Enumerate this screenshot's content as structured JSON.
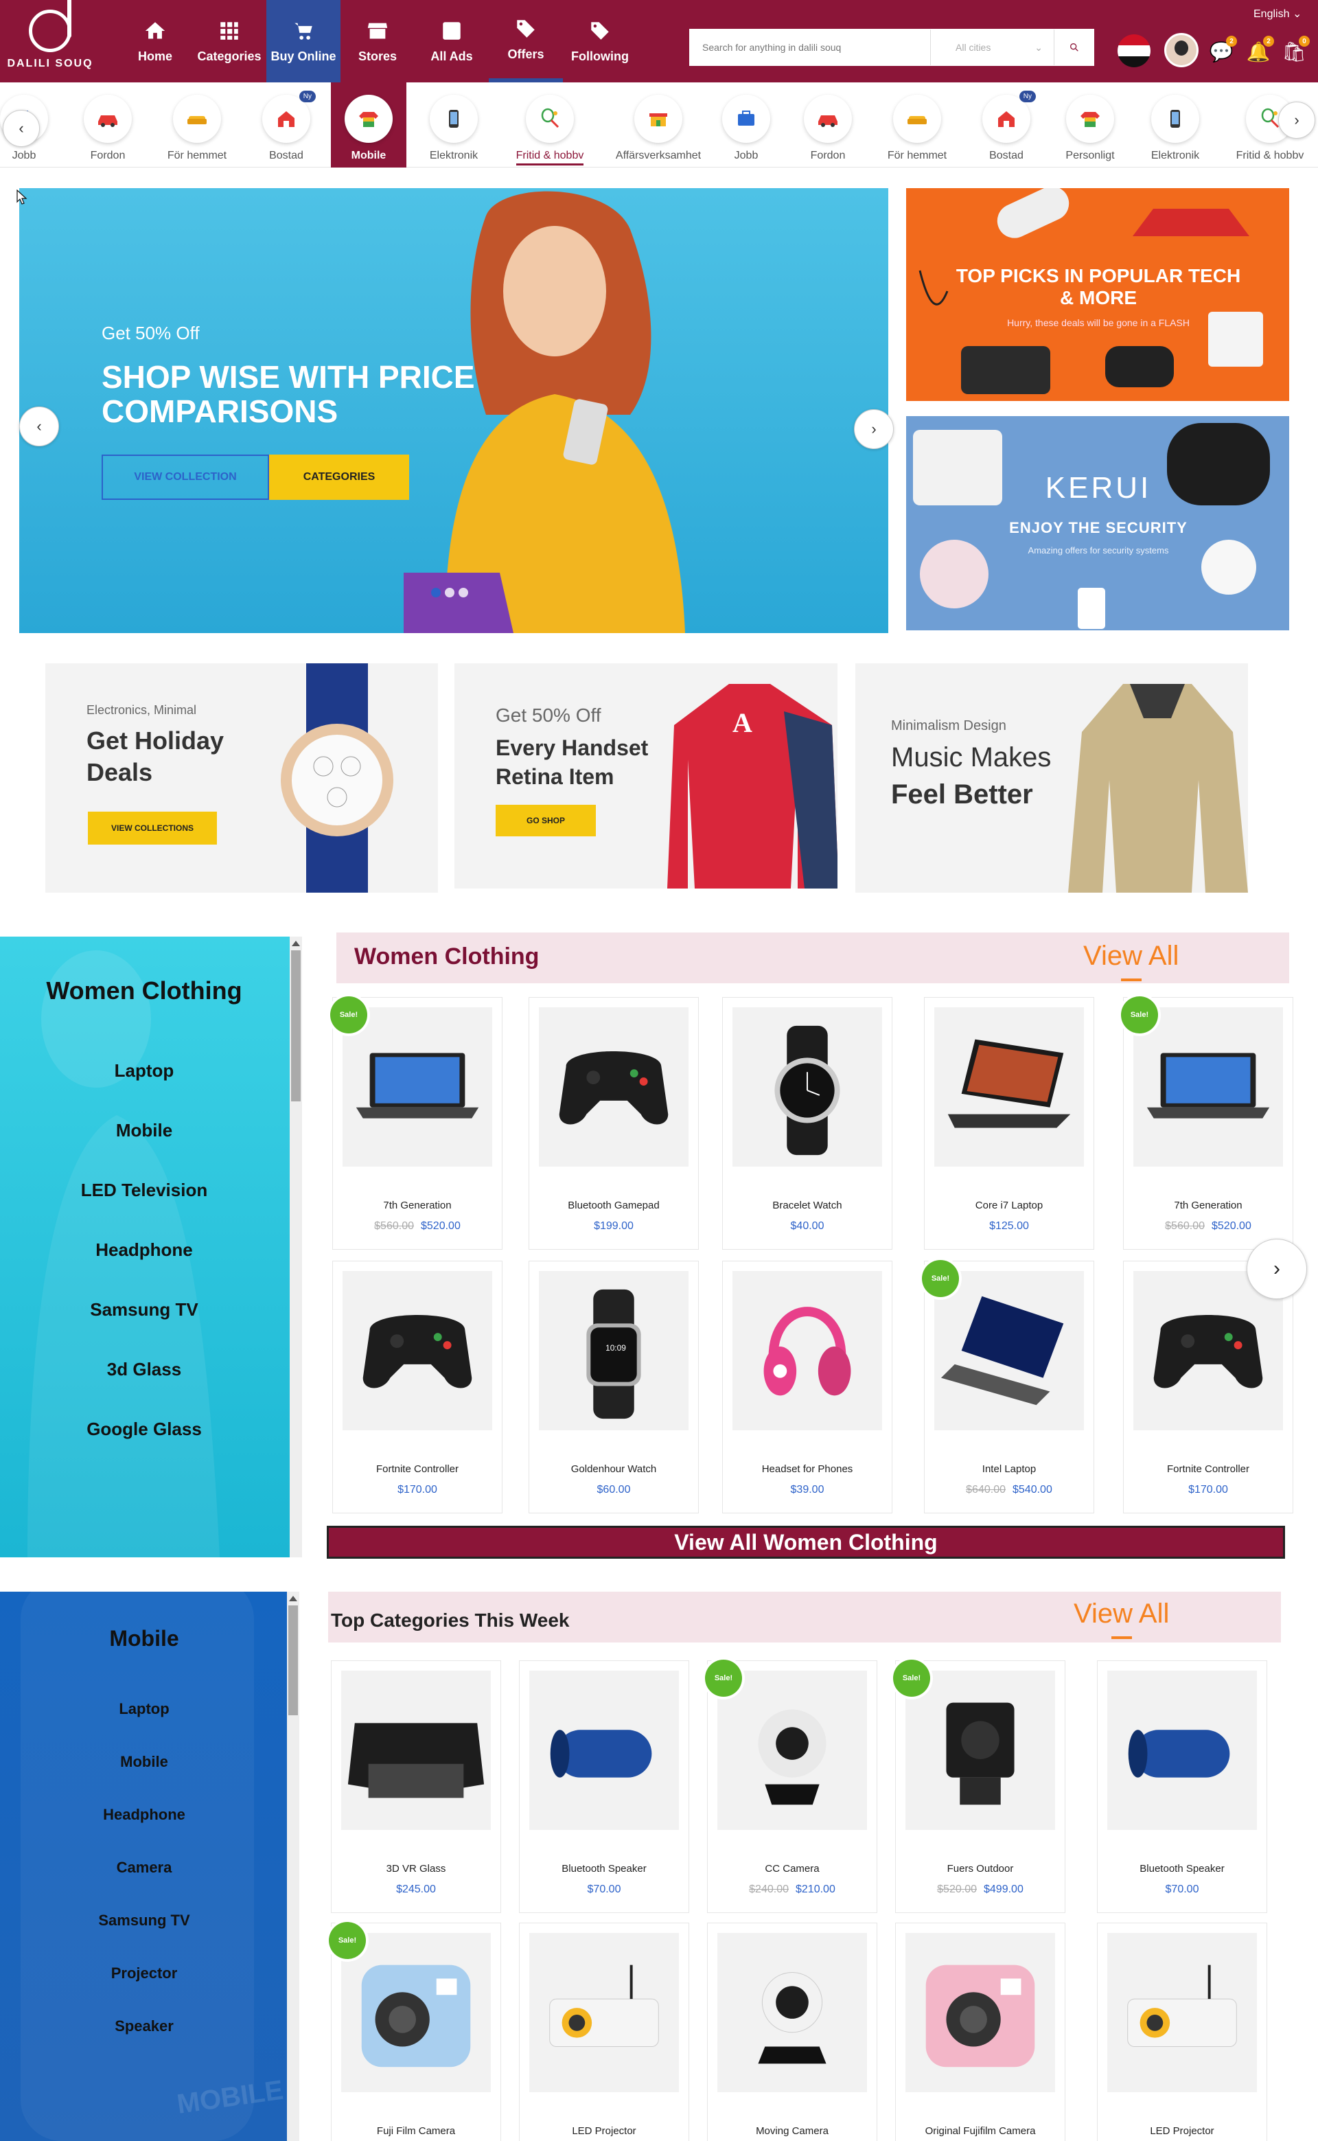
{
  "brand": {
    "name": "DALILI SOUQ"
  },
  "topbar": {
    "language": "English",
    "nav": [
      {
        "label": "Home",
        "icon": "home-icon"
      },
      {
        "label": "Categories",
        "icon": "grid-icon"
      },
      {
        "label": "Buy Online",
        "icon": "cart-icon"
      },
      {
        "label": "Stores",
        "icon": "store-icon"
      },
      {
        "label": "All Ads",
        "icon": "ad-icon"
      },
      {
        "label": "Offers",
        "icon": "tag-icon"
      },
      {
        "label": "Following",
        "icon": "tag-icon"
      }
    ],
    "search_placeholder": "Search for anything in dalili souq",
    "city": "All cities",
    "badges": {
      "messages": "2",
      "notifications": "2",
      "cart": "0"
    }
  },
  "categories": [
    {
      "label": "Jobb",
      "icon": "briefcase-icon"
    },
    {
      "label": "Fordon",
      "icon": "car-icon"
    },
    {
      "label": "För hemmet",
      "icon": "sofa-icon"
    },
    {
      "label": "Bostad",
      "icon": "house-icon",
      "new": "Ny"
    },
    {
      "label": "Mobile",
      "icon": "shirt-icon"
    },
    {
      "label": "Elektronik",
      "icon": "phone-icon"
    },
    {
      "label": "Fritid & hobbv",
      "icon": "racket-icon"
    },
    {
      "label": "Affärsverksamhet",
      "icon": "shop-icon"
    },
    {
      "label": "Jobb",
      "icon": "briefcase-icon"
    },
    {
      "label": "Fordon",
      "icon": "car-icon"
    },
    {
      "label": "För hemmet",
      "icon": "sofa-icon"
    },
    {
      "label": "Bostad",
      "icon": "house-icon",
      "new": "Ny"
    },
    {
      "label": "Personligt",
      "icon": "shirt-icon"
    },
    {
      "label": "Elektronik",
      "icon": "phone-icon"
    },
    {
      "label": "Fritid & hobbv",
      "icon": "racket-icon"
    }
  ],
  "hero": {
    "subtitle": "Get 50% Off",
    "title": "SHOP WISE WITH PRICE COMPARISONS",
    "btn_primary": "VIEW COLLECTION",
    "btn_secondary": "CATEGORIES"
  },
  "side_banners": [
    {
      "title": "TOP PICKS IN POPULAR TECH & MORE",
      "subtitle": "Hurry, these deals will be gone in a FLASH"
    },
    {
      "brand": "KERUI",
      "title": "ENJOY THE SECURITY",
      "subtitle": "Amazing offers for security systems"
    }
  ],
  "promos": [
    {
      "small": "Electronics, Minimal",
      "big1": "Get Holiday",
      "big2": "Deals",
      "btn": "VIEW COLLECTIONS"
    },
    {
      "small": "Get 50% Off",
      "big1": "Every Handset",
      "big2": "Retina Item",
      "btn": "GO SHOP"
    },
    {
      "small": "Minimalism Design",
      "big1": "Music Makes",
      "big2": "Feel Better"
    }
  ],
  "women_sidebar": {
    "title": "Women Clothing",
    "links": [
      "Laptop",
      "Mobile",
      "LED Television",
      "Headphone",
      "Samsung TV",
      "3d Glass",
      "Google Glass"
    ]
  },
  "women_section": {
    "title": "Women Clothing",
    "view_all": "View All",
    "view_all_bar": "View All Women Clothing",
    "products": [
      {
        "name": "7th Generation",
        "old": "$560.00",
        "price": "$520.00",
        "sale": "Sale!",
        "img": "laptop"
      },
      {
        "name": "Bluetooth Gamepad",
        "old": "",
        "price": "$199.00",
        "sale": "",
        "img": "gamepad"
      },
      {
        "name": "Bracelet Watch",
        "old": "",
        "price": "$40.00",
        "sale": "",
        "img": "watch"
      },
      {
        "name": "Core i7 Laptop",
        "old": "",
        "price": "$125.00",
        "sale": "",
        "img": "laptop2"
      },
      {
        "name": "7th Generation",
        "old": "$560.00",
        "price": "$520.00",
        "sale": "Sale!",
        "img": "laptop"
      },
      {
        "name": "Fortnite Controller",
        "old": "",
        "price": "$170.00",
        "sale": "",
        "img": "gamepad"
      },
      {
        "name": "Goldenhour Watch",
        "old": "",
        "price": "$60.00",
        "sale": "",
        "img": "watch2"
      },
      {
        "name": "Headset for Phones",
        "old": "",
        "price": "$39.00",
        "sale": "",
        "img": "headphone"
      },
      {
        "name": "Intel Laptop",
        "old": "$640.00",
        "price": "$540.00",
        "sale": "Sale!",
        "img": "laptop3"
      },
      {
        "name": "Fortnite Controller",
        "old": "",
        "price": "$170.00",
        "sale": "",
        "img": "gamepad"
      }
    ]
  },
  "mobile_sidebar": {
    "title": "Mobile",
    "links": [
      "Laptop",
      "Mobile",
      "Headphone",
      "Camera",
      "Samsung TV",
      "Projector",
      "Speaker"
    ]
  },
  "top_section": {
    "title": "Top Categories This Week",
    "view_all": "View All",
    "products": [
      {
        "name": "3D VR Glass",
        "old": "",
        "price": "$245.00",
        "sale": "",
        "img": "vr"
      },
      {
        "name": "Bluetooth Speaker",
        "old": "",
        "price": "$70.00",
        "sale": "",
        "img": "speaker"
      },
      {
        "name": "CC Camera",
        "old": "$240.00",
        "price": "$210.00",
        "sale": "Sale!",
        "img": "cccam"
      },
      {
        "name": "Fuers Outdoor",
        "old": "$520.00",
        "price": "$499.00",
        "sale": "Sale!",
        "img": "gopro"
      },
      {
        "name": "Bluetooth Speaker",
        "old": "",
        "price": "$70.00",
        "sale": "",
        "img": "speaker"
      },
      {
        "name": "Fuji Film Camera",
        "old": "",
        "price": "",
        "sale": "Sale!",
        "img": "instax"
      },
      {
        "name": "LED Projector",
        "old": "",
        "price": "",
        "sale": "",
        "img": "projector"
      },
      {
        "name": "Moving Camera",
        "old": "",
        "price": "",
        "sale": "",
        "img": "webcam"
      },
      {
        "name": "Original Fujifilm Camera",
        "old": "",
        "price": "",
        "sale": "",
        "img": "instaxpink"
      },
      {
        "name": "LED Projector",
        "old": "",
        "price": "",
        "sale": "",
        "img": "projector"
      }
    ]
  }
}
